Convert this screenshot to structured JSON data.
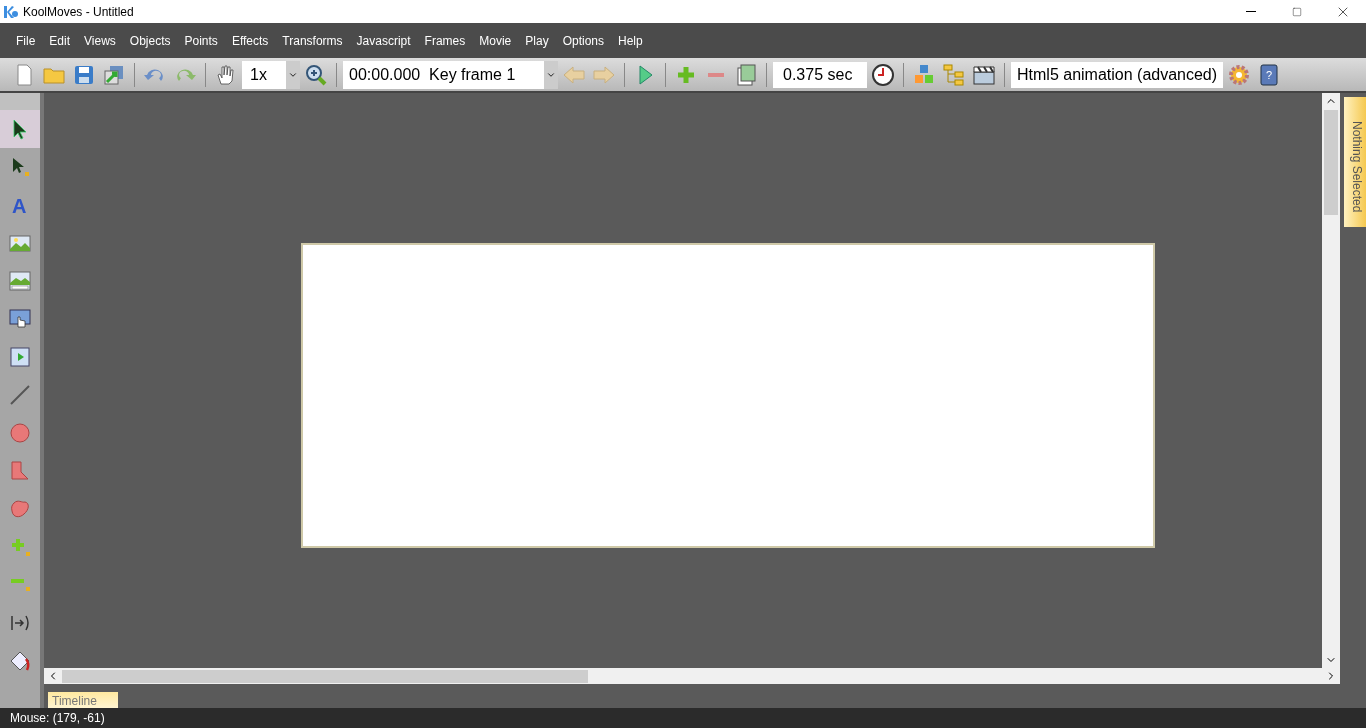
{
  "window": {
    "title": "KoolMoves - Untitled"
  },
  "menu": [
    "File",
    "Edit",
    "Views",
    "Objects",
    "Points",
    "Effects",
    "Transforms",
    "Javascript",
    "Frames",
    "Movie",
    "Play",
    "Options",
    "Help"
  ],
  "toolbar": {
    "zoom": "1x",
    "frame": "00:00.000  Key frame 1",
    "duration": "0.375 sec",
    "export": "Html5 animation (advanced)",
    "help_glyph": "?"
  },
  "tools": [
    {
      "kind": "select",
      "selected": true
    },
    {
      "kind": "subselect",
      "selected": false
    },
    {
      "kind": "text",
      "selected": false,
      "glyph": "A"
    },
    {
      "kind": "image",
      "selected": false
    },
    {
      "kind": "slideshow",
      "selected": false
    },
    {
      "kind": "button",
      "selected": false
    },
    {
      "kind": "video",
      "selected": false
    },
    {
      "kind": "line",
      "selected": false
    },
    {
      "kind": "circle",
      "selected": false
    },
    {
      "kind": "polygon",
      "selected": false
    },
    {
      "kind": "blob",
      "selected": false
    },
    {
      "kind": "addpoint",
      "selected": false
    },
    {
      "kind": "removepoint",
      "selected": false
    },
    {
      "kind": "motion",
      "selected": false
    },
    {
      "kind": "fill",
      "selected": false
    }
  ],
  "side_tab": "Nothing Selected",
  "bottom_tab": "Timeline",
  "status_bar": "Mouse: (179, -61)"
}
